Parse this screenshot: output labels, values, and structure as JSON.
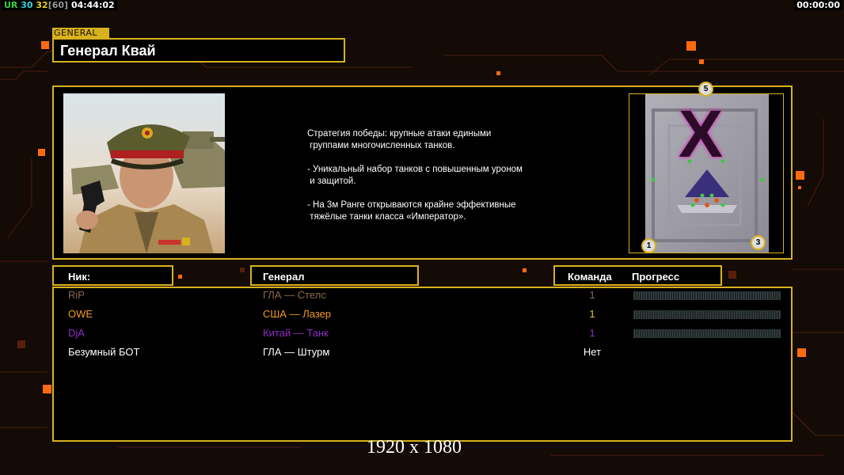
{
  "hud": {
    "left_label": "UR",
    "val1": "30",
    "val2": "32",
    "val3": "[60]",
    "time_left": "04:44:02",
    "time_right": "00:00:00"
  },
  "general": {
    "tag": "GENERAL",
    "name": "Генерал Квай",
    "description": [
      "Стратегия победы: крупные атаки едиными",
      " группами многочисленных танков.",
      "",
      "- Уникальный набор танков с повышенным уроном",
      " и защитой.",
      "",
      "- На 3м Ранге открываются крайне эффективные",
      " тяжёлые танки класса «Император»."
    ]
  },
  "map": {
    "letter": "X",
    "slot_top": "5",
    "slot_bl": "1",
    "slot_br": "3"
  },
  "table": {
    "headers": {
      "nick": "Ник:",
      "general": "Генерал",
      "team": "Команда",
      "progress": "Прогресс"
    },
    "rows": [
      {
        "nick": "RiP",
        "general": "ГЛА — Стелс",
        "team": "1",
        "nick_color": "#8a6a4e",
        "team_color": "#8a6a4e",
        "has_bar": true
      },
      {
        "nick": "OWE",
        "general": "США — Лазер",
        "team": "1",
        "nick_color": "#f39c1e",
        "team_color": "#f3c21e",
        "has_bar": true
      },
      {
        "nick": "DjA",
        "general": "Китай — Танк",
        "team": "1",
        "nick_color": "#8e2ec4",
        "team_color": "#8e2ec4",
        "has_bar": true
      },
      {
        "nick": "Безумный БОТ",
        "general": "ГЛА — Штурм",
        "team": "Нет",
        "nick_color": "#ffffff",
        "team_color": "#ffffff",
        "has_bar": false
      }
    ]
  },
  "overlay": {
    "resolution": "1920 x 1080"
  },
  "colors": {
    "accent": "#d8b21e",
    "hud_green": "#35d24a",
    "hud_cyan": "#2fd6e0",
    "hud_yellow": "#e8d11e",
    "hud_gray": "#9a9a9a"
  }
}
